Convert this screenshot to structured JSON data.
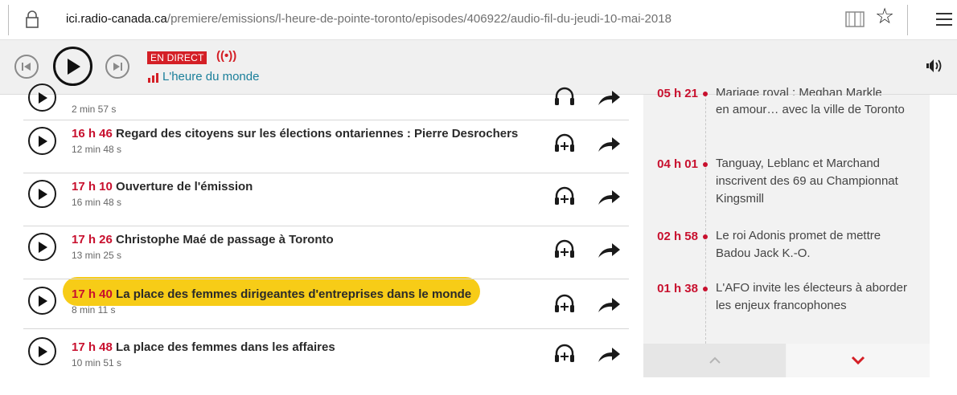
{
  "browser": {
    "url_domain": "ici.radio-canada.ca",
    "url_path": "/premiere/emissions/l-heure-de-pointe-toronto/episodes/406922/audio-fil-du-jeudi-10-mai-2018",
    "icons": [
      "lock-icon",
      "reading-view-icon",
      "favorite-star-icon",
      "menu-icon"
    ]
  },
  "player": {
    "live_badge": "EN DIRECT",
    "live_symbol": "((•))",
    "show_name": "L'heure du monde",
    "icons": [
      "previous-icon",
      "play-icon",
      "next-icon",
      "volume-icon"
    ]
  },
  "episodes": {
    "partial_duration": "2 min 57 s",
    "items": [
      {
        "time": "16 h 46",
        "title": "Regard des citoyens sur les élections ontariennes :  Pierre Desrochers",
        "duration": "12 min 48 s"
      },
      {
        "time": "17 h 10",
        "title": "Ouverture de l'émission",
        "duration": "16 min 48 s"
      },
      {
        "time": "17 h 26",
        "title": "Christophe Maé de passage à Toronto",
        "duration": "13 min 25 s"
      },
      {
        "time": "17 h 40",
        "title": "La place des femmes dirigeantes d'entreprises dans le monde",
        "duration": "8 min 11 s",
        "highlighted": true
      },
      {
        "time": "17 h 48",
        "title": "La place des femmes dans les affaires",
        "duration": "10 min 51 s"
      }
    ]
  },
  "news": {
    "partial": {
      "time": "05 h 21",
      "text_cut": "Mariage royal : Meghan Markle",
      "text_rest": "en amour… avec la ville de Toronto"
    },
    "items": [
      {
        "time": "04 h 01",
        "text": "Tanguay, Leblanc et Marchand inscrivent des 69 au Championnat Kingsmill"
      },
      {
        "time": "02 h 58",
        "text": "Le roi Adonis promet de mettre Badou Jack K.-O."
      },
      {
        "time": "01 h 38",
        "text": "L'AFO invite les électeurs à aborder les enjeux francophones"
      }
    ]
  },
  "colors": {
    "accent_red": "#c8102e",
    "highlight_yellow": "#f7cc17",
    "link_teal": "#1a7f9a"
  }
}
